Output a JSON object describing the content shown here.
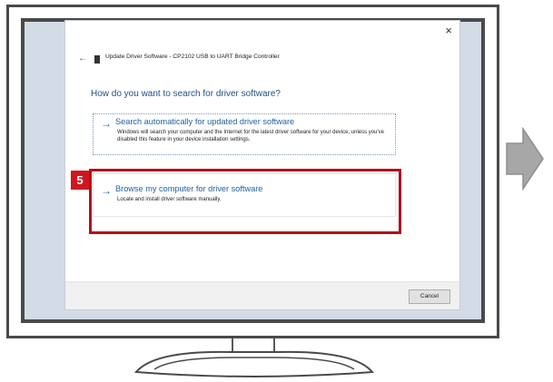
{
  "dialog": {
    "close_glyph": "×",
    "back_glyph": "←",
    "title": "Update Driver Software - CP2102 USB to UART Bridge Controller",
    "question": "How do you want to search for driver software?",
    "options": [
      {
        "arrow": "→",
        "heading": "Search automatically for updated driver software",
        "description": "Windows will search your computer and the Internet for the latest driver software for your device, unless you've disabled this feature in your device installation settings."
      },
      {
        "arrow": "→",
        "heading": "Browse my computer for driver software",
        "description": "Locate and install driver software manually."
      }
    ],
    "cancel_label": "Cancel"
  },
  "annotation": {
    "step_number": "5",
    "highlight_color": "#b0121a",
    "badge_color": "#d01620"
  },
  "icons": [
    "back-arrow-icon",
    "close-icon",
    "device-icon",
    "right-arrow-icon",
    "next-step-arrow-icon"
  ]
}
